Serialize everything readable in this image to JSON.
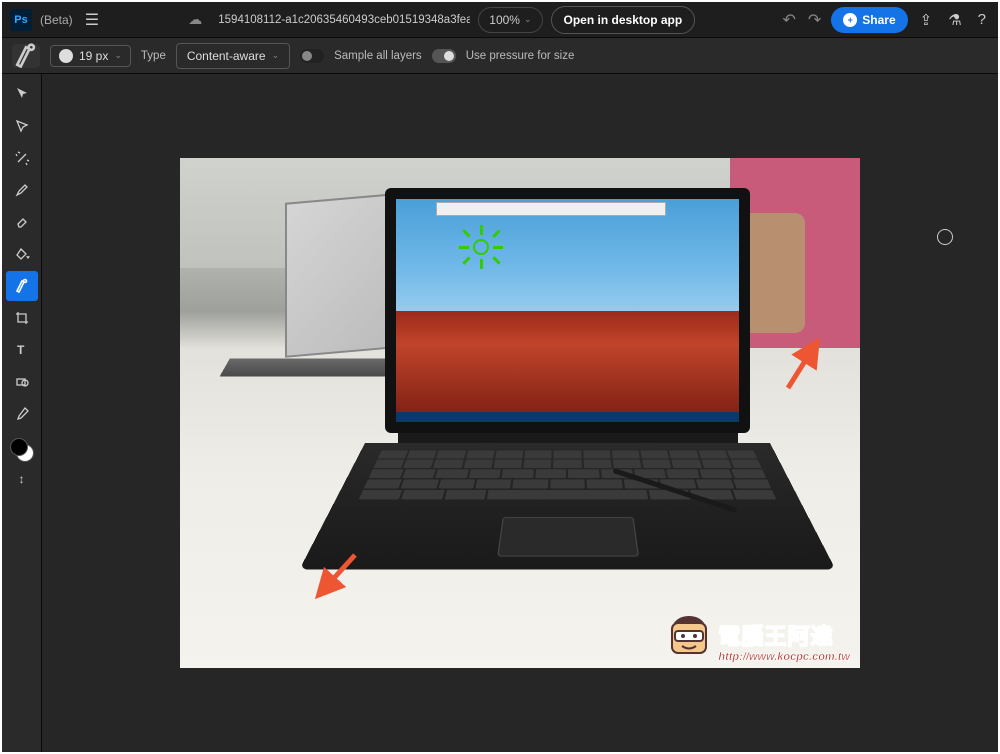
{
  "header": {
    "beta_label": "(Beta)",
    "filename": "1594108112-a1c20635460493ceb01519348a3fea...",
    "zoom": "100%",
    "open_desktop": "Open in desktop app",
    "share": "Share"
  },
  "options": {
    "brush_size": "19 px",
    "type_label": "Type",
    "type_value": "Content-aware",
    "sample_all": "Sample all layers",
    "pressure": "Use pressure for size"
  },
  "tools": {
    "list": [
      "move",
      "lasso",
      "wand",
      "brush",
      "eraser",
      "clone",
      "healing",
      "crop",
      "type",
      "hand",
      "eyedrop"
    ],
    "active": "healing"
  },
  "watermark": {
    "name": "電腦王阿達",
    "url": "http://www.kocpc.com.tw"
  }
}
